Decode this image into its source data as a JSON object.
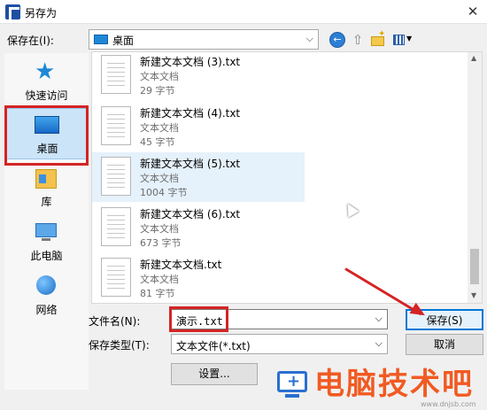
{
  "window": {
    "title": "另存为",
    "close_glyph": "✕"
  },
  "location": {
    "label": "保存在(I):",
    "value": "桌面"
  },
  "places": [
    {
      "label": "快速访问",
      "icon": "star-icon"
    },
    {
      "label": "桌面",
      "icon": "desktop-icon",
      "selected": true
    },
    {
      "label": "库",
      "icon": "library-icon"
    },
    {
      "label": "此电脑",
      "icon": "computer-icon"
    },
    {
      "label": "网络",
      "icon": "network-icon"
    }
  ],
  "files": [
    {
      "name": "新建文本文档 (3).txt",
      "type": "文本文档",
      "size": "29 字节"
    },
    {
      "name": "新建文本文档 (4).txt",
      "type": "文本文档",
      "size": "45 字节"
    },
    {
      "name": "新建文本文档 (5).txt",
      "type": "文本文档",
      "size": "1004 字节",
      "selected": true
    },
    {
      "name": "新建文本文档 (6).txt",
      "type": "文本文档",
      "size": "673 字节"
    },
    {
      "name": "新建文本文档.txt",
      "type": "文本文档",
      "size": "81 字节"
    }
  ],
  "filename": {
    "label": "文件名(N):",
    "value": "演示.txt"
  },
  "filetype": {
    "label": "保存类型(T):",
    "value": "文本文件(*.txt)"
  },
  "buttons": {
    "save": "保存(S)",
    "cancel": "取消",
    "settings": "设置..."
  },
  "watermark": {
    "text": "电脑技术吧",
    "url": "www.dnjsb.com"
  },
  "colors": {
    "highlight": "#d42424",
    "selection": "#cce4f7",
    "accent": "#0078d7",
    "watermark": "#f15a22"
  }
}
